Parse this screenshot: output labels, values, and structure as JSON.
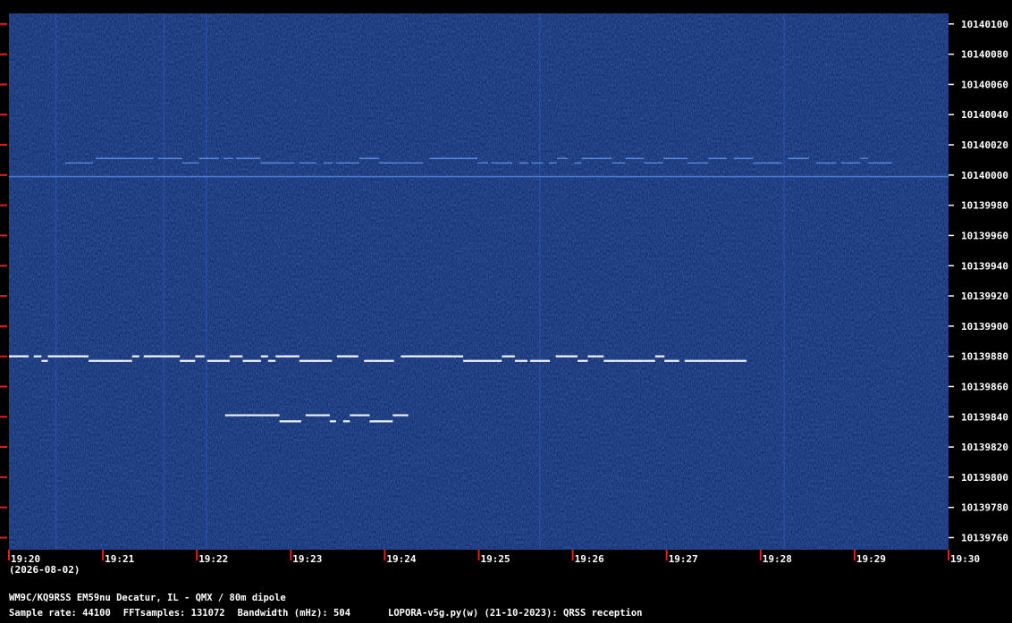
{
  "chart_data": {
    "type": "heatmap",
    "x_ticks": [
      "19:20",
      "19:21",
      "19:22",
      "19:23",
      "19:24",
      "19:25",
      "19:26",
      "19:27",
      "19:28",
      "19:29",
      "19:30"
    ],
    "y_ticks": [
      10140100,
      10140080,
      10140060,
      10140040,
      10140020,
      10140000,
      10139980,
      10139960,
      10139940,
      10139920,
      10139900,
      10139880,
      10139860,
      10139840,
      10139820,
      10139800,
      10139780,
      10139760
    ],
    "y_range": [
      10139752,
      10140107
    ],
    "x_range_minutes": [
      0,
      10
    ],
    "background": "dark blue noise",
    "signals": [
      {
        "name": "",
        "freq": 10139877,
        "start_min": 0.0,
        "end_min": 7.85,
        "shift_hz": 3,
        "color": "#ffffff"
      },
      {
        "name": "",
        "freq": 10139837,
        "start_min": 2.3,
        "end_min": 4.25,
        "shift_hz": 4,
        "color": "#ffffff"
      },
      {
        "name": "",
        "freq": 10140008,
        "start_min": 0.6,
        "end_min": 9.4,
        "shift_hz": 3,
        "color": "#6fa8ff"
      },
      {
        "name": "",
        "freq": 10139999,
        "start_min": 0.0,
        "end_min": 10.0,
        "shift_hz": 0,
        "color": "#4f86e8"
      }
    ]
  },
  "date_label": "(2026-08-02)",
  "footer": {
    "station": "WM9C/KQ9RSS EM59nu Decatur, IL - QMX / 80m dipole",
    "sample_rate": "Sample rate: 44100",
    "fft_samples": "FFTsamples: 131072",
    "bandwidth": "Bandwidth (mHz): 504",
    "software": "LOPORA-v5g.py(w) (21-10-2023): QRSS reception"
  },
  "colors": {
    "background": "#0b1f5c",
    "tick_mark": "#e0201e",
    "text": "#ffffff",
    "signal": "#ffffff"
  }
}
